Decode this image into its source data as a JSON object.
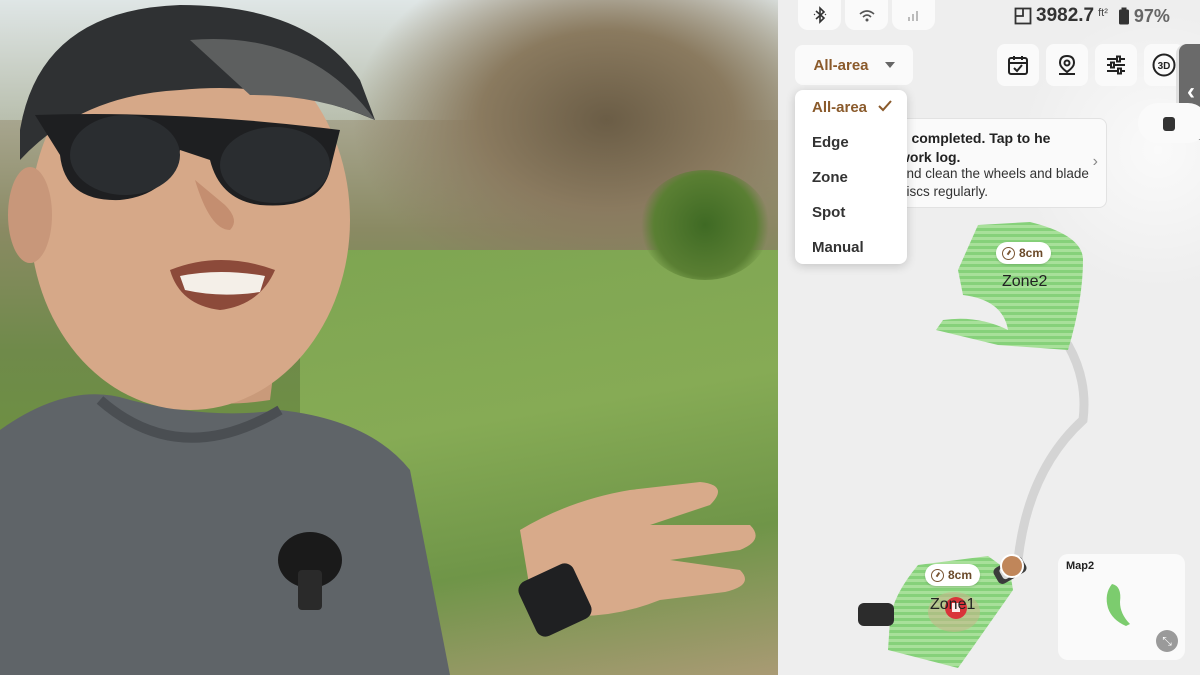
{
  "status": {
    "area_value": "3982.7",
    "area_unit": "ft²",
    "battery": "97%",
    "icons": [
      "bluetooth-icon",
      "wifi-icon",
      "cellular-icon",
      "map-area-icon",
      "battery-icon"
    ]
  },
  "mode": {
    "selected": "All-area",
    "options": [
      "All-area",
      "Edge",
      "Zone",
      "Spot",
      "Manual"
    ]
  },
  "toolbar": {
    "buttons": [
      "schedule-icon",
      "map-pin-icon",
      "settings-sliders-icon"
    ],
    "view_3d_label": "3D"
  },
  "notice": {
    "title": "g completed. Tap to he work log.",
    "body": "and clean the wheels and blade discs regularly."
  },
  "map": {
    "zones": [
      {
        "name": "Zone2",
        "cut_height": "8cm"
      },
      {
        "name": "Zone1",
        "cut_height": "8cm"
      }
    ],
    "zone_color": "#86d17a"
  },
  "minimap": {
    "name": "Map2"
  },
  "colors": {
    "accent": "#8a5a2b",
    "zone_fill": "#a8e09a",
    "panel_bg": "#eeeeee"
  }
}
